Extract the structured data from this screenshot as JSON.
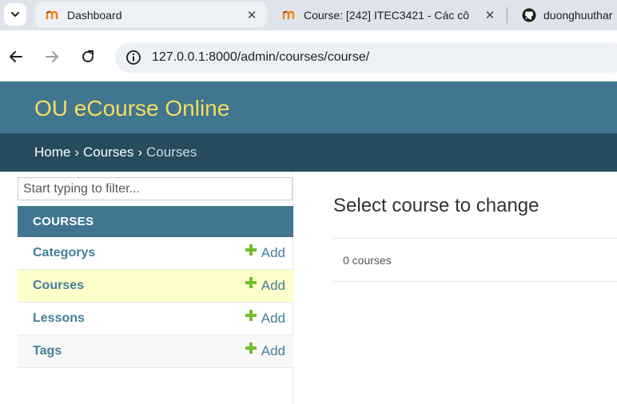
{
  "browser": {
    "tabs": [
      {
        "title": "Dashboard",
        "favicon": "moodle-icon",
        "active": true
      },
      {
        "title": "Course: [242] ITEC3421 - Các cô",
        "favicon": "moodle-icon",
        "active": false
      },
      {
        "title": "duonghuuthar",
        "favicon": "github-icon",
        "active": false
      }
    ],
    "url": "127.0.0.1:8000/admin/courses/course/"
  },
  "admin": {
    "branding": "OU eCourse Online",
    "breadcrumbs": {
      "home": "Home",
      "sep": "›",
      "app": "Courses",
      "current": "Courses"
    },
    "sidebar": {
      "filter_placeholder": "Start typing to filter...",
      "module_caption": "COURSES",
      "add_label": "Add",
      "models": [
        {
          "name": "Categorys",
          "current": false
        },
        {
          "name": "Courses",
          "current": true
        },
        {
          "name": "Lessons",
          "current": false
        },
        {
          "name": "Tags",
          "current": false
        }
      ]
    },
    "content": {
      "title": "Select course to change",
      "result_count": "0 courses"
    },
    "colors": {
      "header": "#417690",
      "breadcrumbs": "#264b5d",
      "branding": "#f5dd5d",
      "link": "#447e9b",
      "add_plus": "#70bf2b",
      "current_row": "#ffffcc"
    }
  }
}
